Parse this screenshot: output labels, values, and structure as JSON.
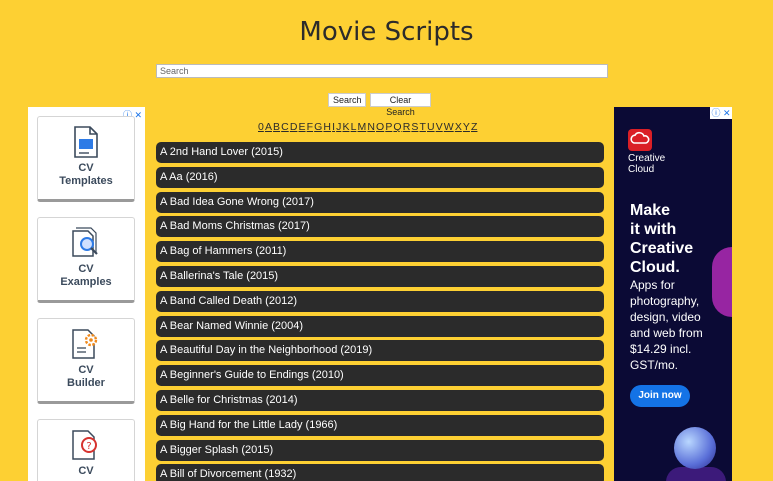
{
  "page_title": "Movie Scripts",
  "search": {
    "placeholder": "Search",
    "value": ""
  },
  "buttons": {
    "search": "Search",
    "clear": "Clear Search"
  },
  "alphabet": [
    "0",
    "A",
    "B",
    "C",
    "D",
    "E",
    "F",
    "G",
    "H",
    "I",
    "J",
    "K",
    "L",
    "M",
    "N",
    "O",
    "P",
    "Q",
    "R",
    "S",
    "T",
    "U",
    "V",
    "W",
    "X",
    "Y",
    "Z"
  ],
  "movies": [
    "A 2nd Hand Lover (2015)",
    "A Aa (2016)",
    "A Bad Idea Gone Wrong (2017)",
    "A Bad Moms Christmas (2017)",
    "A Bag of Hammers (2011)",
    "A Ballerina's Tale (2015)",
    "A Band Called Death (2012)",
    "A Bear Named Winnie (2004)",
    "A Beautiful Day in the Neighborhood (2019)",
    "A Beginner's Guide to Endings (2010)",
    "A Belle for Christmas (2014)",
    "A Big Hand for the Little Lady (1966)",
    "A Bigger Splash (2015)",
    "A Bill of Divorcement (1932)"
  ],
  "left_ad": {
    "choice_icons": "ⓘ ✕",
    "cards": [
      {
        "line1": "CV",
        "line2": "Templates",
        "icon": "document-icon"
      },
      {
        "line1": "CV",
        "line2": "Examples",
        "icon": "document-search-icon"
      },
      {
        "line1": "CV",
        "line2": "Builder",
        "icon": "document-gear-icon"
      },
      {
        "line1": "CV",
        "line2": "",
        "icon": "document-question-icon"
      }
    ]
  },
  "right_ad": {
    "choice_icons": "ⓘ ✕",
    "brand_line1": "Creative",
    "brand_line2": "Cloud",
    "headline": [
      "Make",
      "it with",
      "Creative",
      "Cloud."
    ],
    "sub": [
      "Apps for",
      "photography,",
      "design, video",
      "and web from",
      "$14.29 incl.",
      "GST/mo."
    ],
    "cta": "Join now",
    "brand_color": "#da1f26",
    "cta_color": "#1473e6"
  },
  "colors": {
    "background": "#fdd033",
    "row": "#2b2b2b"
  }
}
